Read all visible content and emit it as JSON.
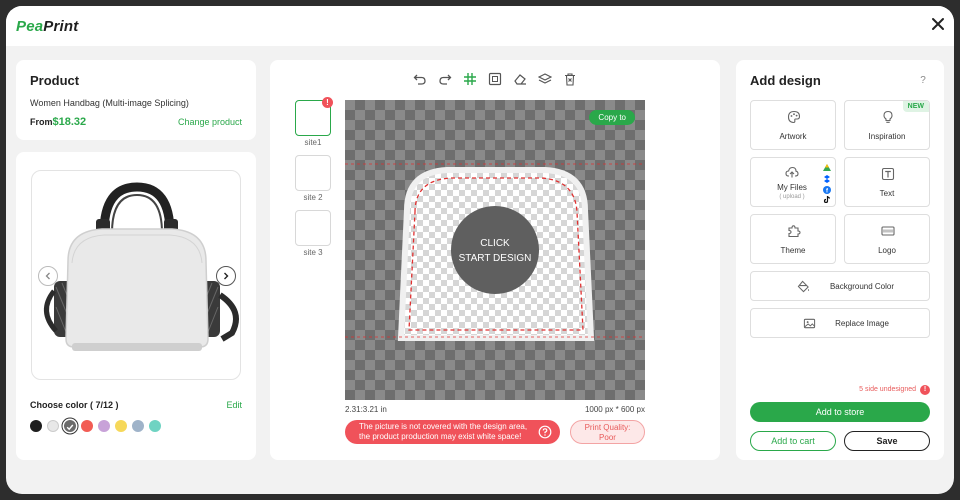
{
  "app": {
    "logo_part1": "Pea",
    "logo_part2": "Print"
  },
  "product": {
    "heading": "Product",
    "name": "Women Handbag (Multi-image Splicing)",
    "from_label": "From",
    "price": "$18.32",
    "change_label": "Change product"
  },
  "color": {
    "label": "Choose color ( 7/12 )",
    "edit_label": "Edit",
    "swatches": [
      "#1e1e1e",
      "#e8e8e8",
      "#6b6b6b",
      "#f25c54",
      "#c8a2d8",
      "#f6d85a",
      "#9fb3c9",
      "#6fd3c2"
    ],
    "selected_index": 2
  },
  "sites": [
    {
      "label": "site1",
      "badge": "!"
    },
    {
      "label": "site 2"
    },
    {
      "label": "site 3"
    }
  ],
  "canvas": {
    "copy_label": "Copy to",
    "cta_line1": "CLICK",
    "cta_line2": "START DESIGN",
    "ratio": "2.31:3.21  in",
    "size": "1000 px * 600 px",
    "warning_line1": "The picture is not covered with the design area,",
    "warning_line2": "the product production may exist white space!",
    "quality_line1": "Print Quality:",
    "quality_line2": "Poor"
  },
  "design": {
    "heading": "Add design",
    "help": "?",
    "cards": {
      "artwork": "Artwork",
      "inspiration": "Inspiration",
      "new_tag": "NEW",
      "my_files": "My Files",
      "upload": "( upload )",
      "text": "Text",
      "theme": "Theme",
      "logo": "Logo",
      "background": "Background Color",
      "replace": "Replace Image"
    },
    "undesigned": "5 side undesigned",
    "add_store": "Add to store",
    "add_cart": "Add to cart",
    "save": "Save"
  },
  "colors": {
    "accent": "#2aa84a",
    "danger": "#f0525a"
  }
}
